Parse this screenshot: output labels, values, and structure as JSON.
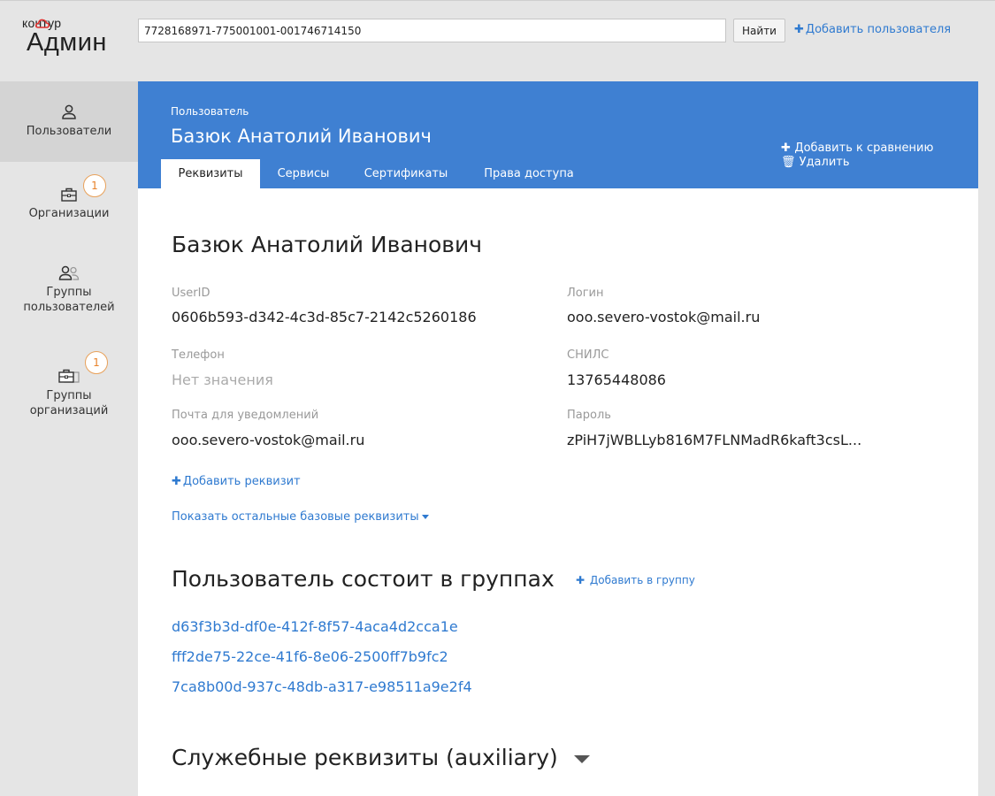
{
  "logo": {
    "small": "контур",
    "big": "Админ"
  },
  "search": {
    "value": "7728168971-775001001-001746714150",
    "button": "Найти"
  },
  "add_user": {
    "label": "Добавить пользователя"
  },
  "sidebar": {
    "items": [
      {
        "label": "Пользователи"
      },
      {
        "label": "Организации",
        "badge": "1"
      },
      {
        "label": "Группы пользователей"
      },
      {
        "label": "Группы организаций",
        "badge": "1"
      }
    ]
  },
  "header": {
    "caption": "Пользователь",
    "name": "Базюк Анатолий Иванович",
    "actions": {
      "compare": "Добавить к сравнению",
      "delete": "Удалить"
    },
    "tabs": [
      {
        "label": "Реквизиты"
      },
      {
        "label": "Сервисы"
      },
      {
        "label": "Сертификаты"
      },
      {
        "label": "Права доступа"
      }
    ]
  },
  "details": {
    "title": "Базюк Анатолий Иванович",
    "fields": {
      "userid": {
        "label": "UserID",
        "value": "0606b593-d342-4c3d-85c7-2142c5260186"
      },
      "login": {
        "label": "Логин",
        "value": "ooo.severo-vostok@mail.ru"
      },
      "phone": {
        "label": "Телефон",
        "value": "Нет значения"
      },
      "snils": {
        "label": "СНИЛС",
        "value": "13765448086"
      },
      "email": {
        "label": "Почта для уведомлений",
        "value": "ooo.severo-vostok@mail.ru"
      },
      "password": {
        "label": "Пароль",
        "value": "zPiH7jWBLLyb816M7FLNMadR6kaft3csL..."
      }
    },
    "add_requisite": "Добавить реквизит",
    "show_more": "Показать остальные базовые реквизиты"
  },
  "groups": {
    "title": "Пользователь состоит в группах",
    "add_label": "Добавить в группу",
    "items": [
      "d63f3b3d-df0e-412f-8f57-4aca4d2cca1e",
      "fff2de75-22ce-41f6-8e06-2500ff7b9fc2",
      "7ca8b00d-937c-48db-a317-e98511a9e2f4"
    ]
  },
  "aux": {
    "title": "Служебные реквизиты (auxiliary)"
  },
  "colors": {
    "accent": "#3f80d2",
    "link": "#2f7ad0",
    "badge": "#e8822a"
  }
}
